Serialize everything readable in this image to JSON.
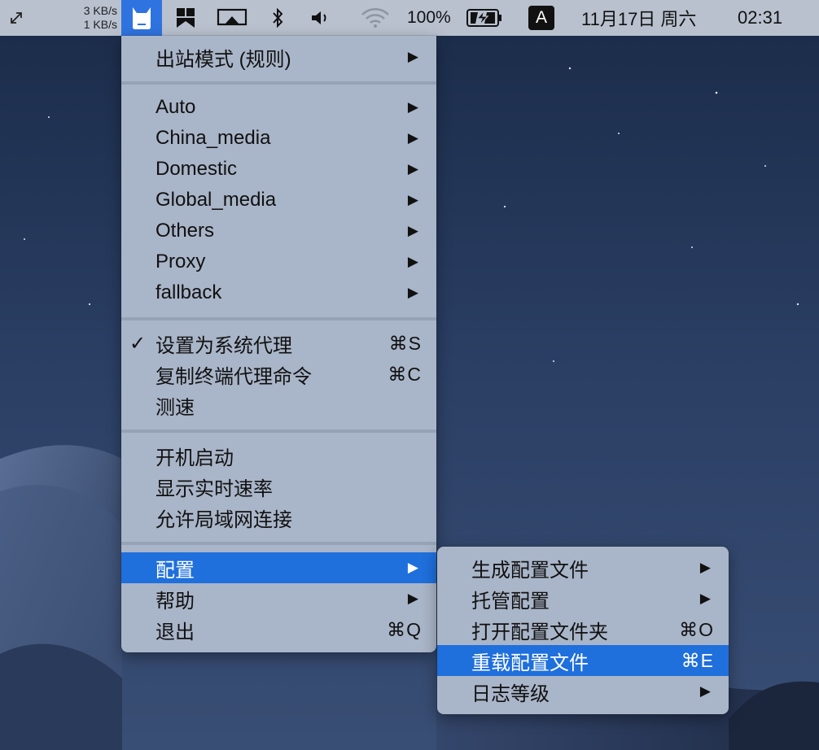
{
  "menubar": {
    "speed_up": "3 KB/s",
    "speed_down": "1 KB/s",
    "battery_percent": "100%",
    "input_source": "A",
    "date": "11月17日 周六",
    "time": "02:31"
  },
  "main_menu": {
    "outbound_mode": "出站模式 (规则)",
    "groups": [
      "Auto",
      "China_media",
      "Domestic",
      "Global_media",
      "Others",
      "Proxy",
      "fallback"
    ],
    "set_system_proxy": "设置为系统代理",
    "set_system_proxy_shortcut": "⌘S",
    "copy_terminal_cmd": "复制终端代理命令",
    "copy_terminal_cmd_shortcut": "⌘C",
    "speed_test": "测速",
    "launch_at_login": "开机启动",
    "show_realtime_speed": "显示实时速率",
    "allow_lan": "允许局域网连接",
    "config": "配置",
    "help": "帮助",
    "quit": "退出",
    "quit_shortcut": "⌘Q",
    "arrow": "▶",
    "check": "✓"
  },
  "sub_menu": {
    "generate_config": "生成配置文件",
    "managed_config": "托管配置",
    "open_config_folder": "打开配置文件夹",
    "open_config_folder_shortcut": "⌘O",
    "reload_config": "重载配置文件",
    "reload_config_shortcut": "⌘E",
    "log_level": "日志等级"
  },
  "colors": {
    "highlight": "#1f6fdc",
    "menu_bg": "#a9b5c8",
    "menubar_bg": "#b9c1cf"
  }
}
